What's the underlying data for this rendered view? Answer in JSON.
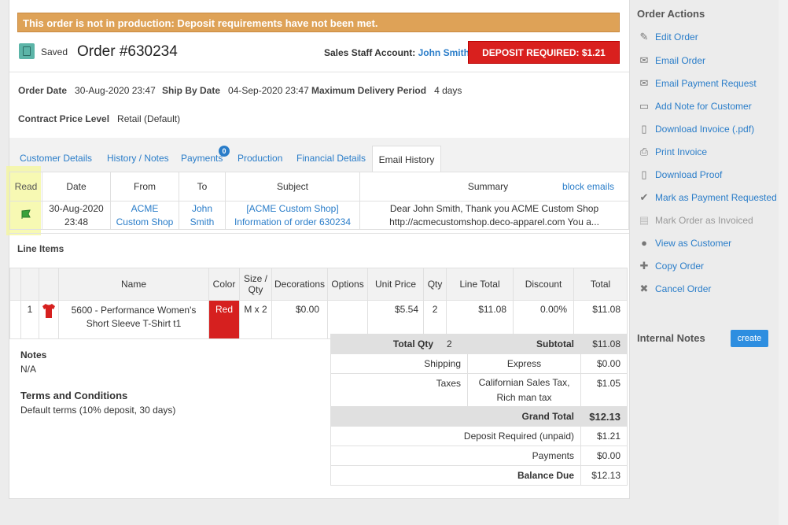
{
  "banner": "This order is not in production: Deposit requirements have not been met.",
  "header": {
    "saved_label": "Saved",
    "order_title": "Order #630234",
    "staff_label": "Sales Staff Account:",
    "staff_name": "John Smith",
    "deposit_button": "DEPOSIT REQUIRED: $1.21"
  },
  "meta": {
    "order_date_label": "Order Date",
    "order_date": "30-Aug-2020 23:47",
    "ship_by_label": "Ship By Date",
    "ship_by": "04-Sep-2020 23:47",
    "max_delivery_label": "Maximum Delivery Period",
    "max_delivery": "4 days",
    "contract_label": "Contract Price Level",
    "contract": "Retail (Default)"
  },
  "tabs": {
    "customer": "Customer Details",
    "history": "History / Notes",
    "payments": "Payments",
    "payments_badge": "0",
    "production": "Production",
    "financial": "Financial Details",
    "email": "Email History"
  },
  "email_table": {
    "headers": [
      "Read",
      "Date",
      "From",
      "To",
      "Subject",
      "Summary"
    ],
    "block_emails": "block emails",
    "row": {
      "date": "30-Aug-2020 23:48",
      "from": "ACME Custom Shop",
      "to": "John Smith",
      "subject": "[ACME Custom Shop] Information of order 630234",
      "summary": "Dear John Smith, Thank you ACME Custom Shop http://acmecustomshop.deco-apparel.com You a..."
    }
  },
  "line_items": {
    "title": "Line Items",
    "headers": [
      "Name",
      "Color",
      "Size / Qty",
      "Decorations",
      "Options",
      "Unit Price",
      "Qty",
      "Line Total",
      "Discount",
      "Total"
    ],
    "row": {
      "num": "1",
      "name": "5600 - Performance Women's Short Sleeve T-Shirt t1",
      "color": "Red",
      "size_qty": "M x 2",
      "decorations": "$0.00",
      "options": "",
      "unit_price": "$5.54",
      "qty": "2",
      "line_total": "$11.08",
      "discount": "0.00%",
      "total": "$11.08"
    }
  },
  "totals": {
    "total_qty_label": "Total Qty",
    "total_qty": "2",
    "subtotal_label": "Subtotal",
    "subtotal": "$11.08",
    "shipping_label": "Shipping",
    "shipping_method": "Express",
    "shipping": "$0.00",
    "taxes_label": "Taxes",
    "taxes_method": "Californian Sales Tax, Rich man tax",
    "taxes": "$1.05",
    "grand_total_label": "Grand Total",
    "grand_total": "$12.13",
    "deposit_label": "Deposit Required (unpaid)",
    "deposit": "$1.21",
    "payments_label": "Payments",
    "payments": "$0.00",
    "balance_label": "Balance Due",
    "balance": "$12.13"
  },
  "notes": {
    "notes_title": "Notes",
    "notes_value": "N/A",
    "terms_title": "Terms and Conditions",
    "terms_value": "Default terms (10% deposit, 30 days)"
  },
  "sidebar": {
    "title": "Order Actions",
    "items": [
      {
        "label": "Edit Order",
        "icon": "pencil-icon"
      },
      {
        "label": "Email Order",
        "icon": "envelope-icon"
      },
      {
        "label": "Email Payment Request",
        "icon": "envelope-dollar-icon"
      },
      {
        "label": "Add Note for Customer",
        "icon": "comment-icon"
      },
      {
        "label": "Download Invoice (.pdf)",
        "icon": "document-icon"
      },
      {
        "label": "Print Invoice",
        "icon": "print-icon"
      },
      {
        "label": "Download Proof",
        "icon": "document-icon"
      },
      {
        "label": "Mark as Payment Requested",
        "icon": "check-icon"
      },
      {
        "label": "Mark Order as Invoiced",
        "icon": "invoice-icon"
      },
      {
        "label": "View as Customer",
        "icon": "user-icon"
      },
      {
        "label": "Copy Order",
        "icon": "plus-icon"
      },
      {
        "label": "Cancel Order",
        "icon": "close-icon"
      }
    ],
    "internal_notes_title": "Internal Notes",
    "create_button": "create"
  },
  "colors": {
    "banner": "#dea257",
    "deposit_button": "#d9201e",
    "link": "#2a7dc9",
    "product_color": "#d6201f",
    "create_button": "#2e8ee0"
  }
}
